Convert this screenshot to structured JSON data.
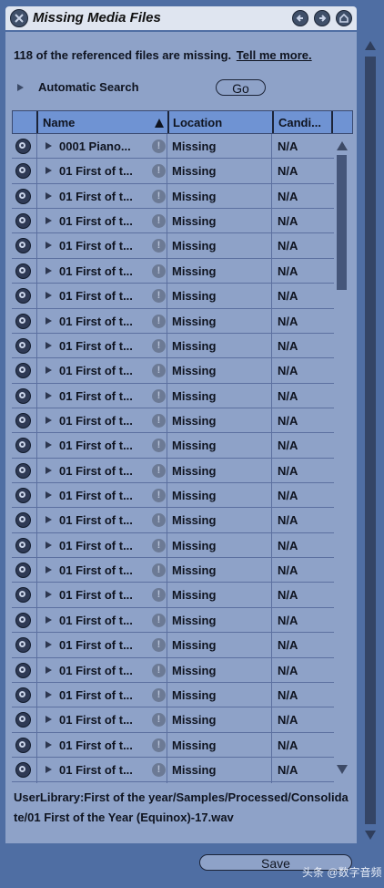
{
  "window": {
    "title": "Missing Media Files"
  },
  "message": {
    "text": "118 of the referenced files are missing.",
    "link": "Tell me more."
  },
  "auto_search": {
    "label": "Automatic Search",
    "button": "Go"
  },
  "table": {
    "columns": [
      "Name",
      "Location",
      "Candi..."
    ],
    "rows": [
      {
        "name": "0001 Piano...",
        "location": "Missing",
        "candidates": "N/A"
      },
      {
        "name": "01 First of t...",
        "location": "Missing",
        "candidates": "N/A"
      },
      {
        "name": "01 First of t...",
        "location": "Missing",
        "candidates": "N/A"
      },
      {
        "name": "01 First of t...",
        "location": "Missing",
        "candidates": "N/A"
      },
      {
        "name": "01 First of t...",
        "location": "Missing",
        "candidates": "N/A"
      },
      {
        "name": "01 First of t...",
        "location": "Missing",
        "candidates": "N/A"
      },
      {
        "name": "01 First of t...",
        "location": "Missing",
        "candidates": "N/A"
      },
      {
        "name": "01 First of t...",
        "location": "Missing",
        "candidates": "N/A"
      },
      {
        "name": "01 First of t...",
        "location": "Missing",
        "candidates": "N/A"
      },
      {
        "name": "01 First of t...",
        "location": "Missing",
        "candidates": "N/A"
      },
      {
        "name": "01 First of t...",
        "location": "Missing",
        "candidates": "N/A"
      },
      {
        "name": "01 First of t...",
        "location": "Missing",
        "candidates": "N/A"
      },
      {
        "name": "01 First of t...",
        "location": "Missing",
        "candidates": "N/A"
      },
      {
        "name": "01 First of t...",
        "location": "Missing",
        "candidates": "N/A"
      },
      {
        "name": "01 First of t...",
        "location": "Missing",
        "candidates": "N/A"
      },
      {
        "name": "01 First of t...",
        "location": "Missing",
        "candidates": "N/A"
      },
      {
        "name": "01 First of t...",
        "location": "Missing",
        "candidates": "N/A"
      },
      {
        "name": "01 First of t...",
        "location": "Missing",
        "candidates": "N/A"
      },
      {
        "name": "01 First of t...",
        "location": "Missing",
        "candidates": "N/A"
      },
      {
        "name": "01 First of t...",
        "location": "Missing",
        "candidates": "N/A"
      },
      {
        "name": "01 First of t...",
        "location": "Missing",
        "candidates": "N/A"
      },
      {
        "name": "01 First of t...",
        "location": "Missing",
        "candidates": "N/A"
      },
      {
        "name": "01 First of t...",
        "location": "Missing",
        "candidates": "N/A"
      },
      {
        "name": "01 First of t...",
        "location": "Missing",
        "candidates": "N/A"
      },
      {
        "name": "01 First of t...",
        "location": "Missing",
        "candidates": "N/A"
      },
      {
        "name": "01 First of t...",
        "location": "Missing",
        "candidates": "N/A"
      }
    ]
  },
  "path": "UserLibrary:First of the year/Samples/Processed/Consolidate/01 First of the Year (Equinox)-17.wav",
  "save_button": "Save",
  "watermark": "头条 @数字音频"
}
